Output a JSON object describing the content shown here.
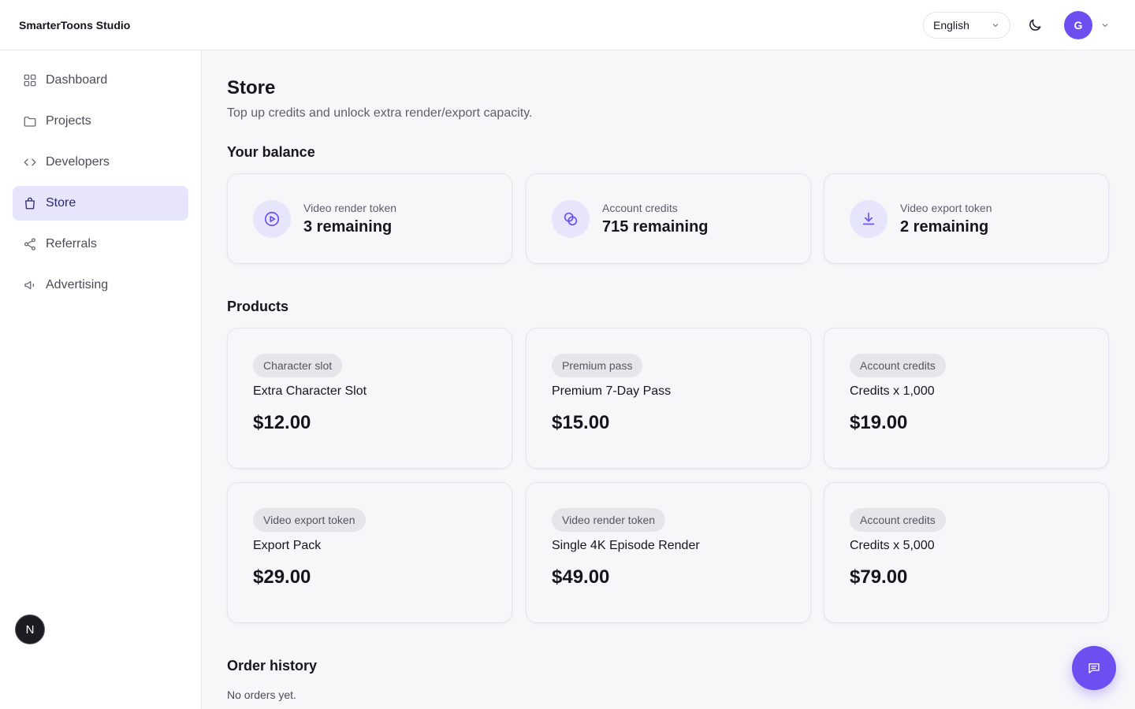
{
  "app": {
    "brand": "SmarterToons Studio"
  },
  "header": {
    "language": "English",
    "avatar_initial": "G"
  },
  "sidebar": {
    "items": [
      {
        "label": "Dashboard",
        "icon": "grid-icon",
        "active": false
      },
      {
        "label": "Projects",
        "icon": "folder-icon",
        "active": false
      },
      {
        "label": "Developers",
        "icon": "code-icon",
        "active": false
      },
      {
        "label": "Store",
        "icon": "shopping-bag-icon",
        "active": true
      },
      {
        "label": "Referrals",
        "icon": "share-icon",
        "active": false
      },
      {
        "label": "Advertising",
        "icon": "megaphone-icon",
        "active": false
      }
    ],
    "dev_badge": "N"
  },
  "page": {
    "title": "Store",
    "subtitle": "Top up credits and unlock extra render/export capacity."
  },
  "balance": {
    "title": "Your balance",
    "items": [
      {
        "label": "Video render token",
        "value": "3 remaining",
        "icon": "play-circle-icon"
      },
      {
        "label": "Account credits",
        "value": "715 remaining",
        "icon": "coins-icon"
      },
      {
        "label": "Video export token",
        "value": "2 remaining",
        "icon": "download-icon"
      }
    ]
  },
  "products": {
    "title": "Products",
    "items": [
      {
        "tag": "Character slot",
        "name": "Extra Character Slot",
        "price": "$12.00"
      },
      {
        "tag": "Premium pass",
        "name": "Premium 7-Day Pass",
        "price": "$15.00"
      },
      {
        "tag": "Account credits",
        "name": "Credits x 1,000",
        "price": "$19.00"
      },
      {
        "tag": "Video export token",
        "name": "Export Pack",
        "price": "$29.00"
      },
      {
        "tag": "Video render token",
        "name": "Single 4K Episode Render",
        "price": "$49.00"
      },
      {
        "tag": "Account credits",
        "name": "Credits x 5,000",
        "price": "$79.00"
      }
    ]
  },
  "orders": {
    "title": "Order history",
    "empty_text": "No orders yet."
  },
  "colors": {
    "accent": "#6d4ef0",
    "active_nav_bg": "#e6e5fb",
    "page_bg": "#f7f7fa"
  }
}
